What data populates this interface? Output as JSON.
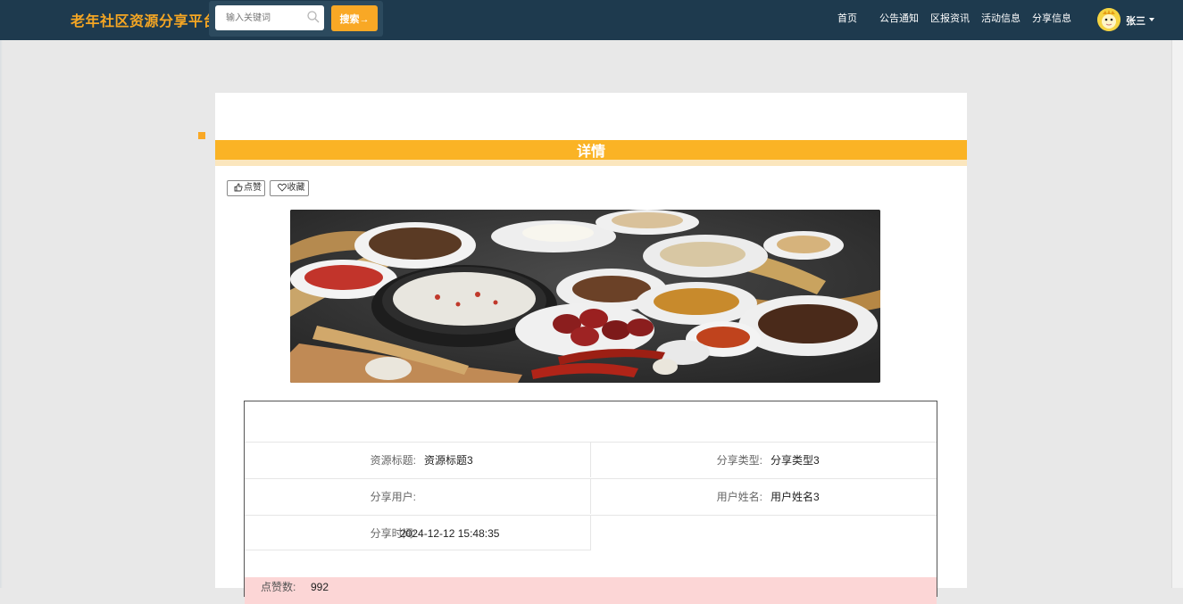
{
  "header": {
    "brand": "老年社区资源分享平台",
    "search": {
      "placeholder": "输入关键词",
      "button_label": "搜索→"
    },
    "nav_links": [
      "首页",
      "公告通知",
      "区报资讯",
      "活动信息",
      "分享信息"
    ],
    "user_name": "张三"
  },
  "section": {
    "title": "详情"
  },
  "actions": {
    "like_label": "点赞",
    "favorite_label": "收藏"
  },
  "details": {
    "rows": [
      {
        "label": "资源标题:",
        "value": "资源标题3"
      },
      {
        "label": "分享类型:",
        "value": "分享类型3"
      },
      {
        "label": "分享用户:",
        "value": ""
      },
      {
        "label": "用户姓名:",
        "value": "用户姓名3"
      },
      {
        "label": "分享时间:",
        "value": "2024-12-12 15:48:35"
      }
    ],
    "likes": {
      "label": "点赞数:",
      "value": "992"
    }
  },
  "colors": {
    "nav_bg": "#1e3a4e",
    "brand": "#f5a623",
    "accent": "#fab325",
    "likes_row_bg": "#fcd6d6"
  }
}
